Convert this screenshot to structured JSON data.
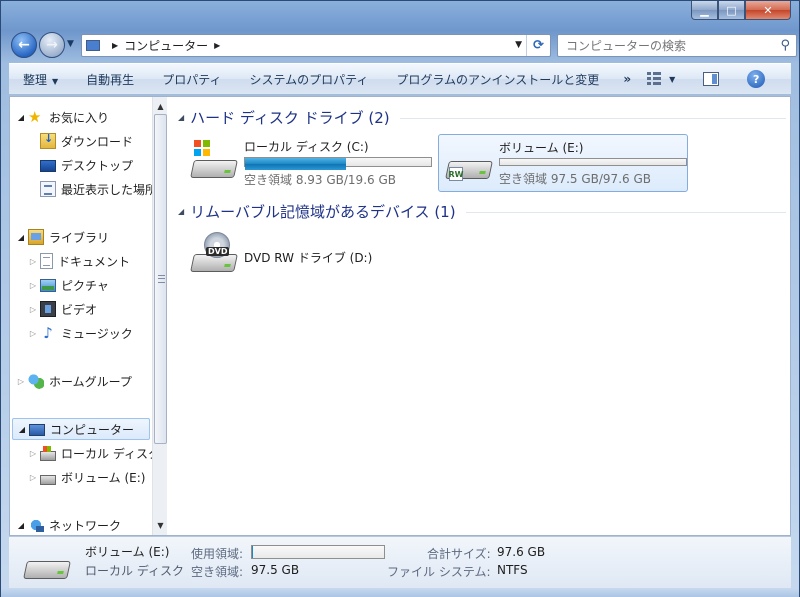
{
  "window": {
    "caption": {
      "minimize": "▁",
      "maximize": "□",
      "close": "✕"
    }
  },
  "nav": {
    "back_icon": "back-arrow-icon",
    "forward_icon": "forward-arrow-icon",
    "address_crumb": "コンピューター",
    "search_placeholder": "コンピューターの検索"
  },
  "commandbar": {
    "organize": "整理",
    "autoplay": "自動再生",
    "properties": "プロパティ",
    "system_properties": "システムのプロパティ",
    "uninstall": "プログラムのアンインストールと変更",
    "more": "»"
  },
  "sidebar": {
    "favorites": "お気に入り",
    "downloads": "ダウンロード",
    "desktop": "デスクトップ",
    "recent": "最近表示した場所",
    "libraries": "ライブラリ",
    "documents": "ドキュメント",
    "pictures": "ピクチャ",
    "videos": "ビデオ",
    "music": "ミュージック",
    "homegroup": "ホームグループ",
    "computer": "コンピューター",
    "local_disk": "ローカル ディスク (C:)",
    "volume_e": "ボリューム (E:)",
    "network": "ネットワーク"
  },
  "main": {
    "group_hdd": "ハード ディスク ドライブ (2)",
    "group_removable": "リムーバブル記憶域があるデバイス (1)",
    "drives": [
      {
        "name": "ローカル ディスク (C:)",
        "free_text": "空き領域 8.93 GB/19.6 GB",
        "used_fraction": 0.544
      },
      {
        "name": "ボリューム (E:)",
        "free_text": "空き領域 97.5 GB/97.6 GB",
        "used_fraction": 0.001
      }
    ],
    "dvd": {
      "name": "DVD RW ドライブ (D:)",
      "badge": "DVD"
    }
  },
  "details": {
    "name": "ボリューム (E:)",
    "type": "ローカル ディスク",
    "used_label": "使用領域:",
    "free_label": "空き領域:",
    "free_value": "97.5 GB",
    "total_label": "合計サイズ:",
    "total_value": "97.6 GB",
    "fs_label": "ファイル システム:",
    "fs_value": "NTFS",
    "used_fraction": 0.001
  },
  "colors": {
    "accent": "#1e86c4",
    "group_header": "#1e3287"
  }
}
